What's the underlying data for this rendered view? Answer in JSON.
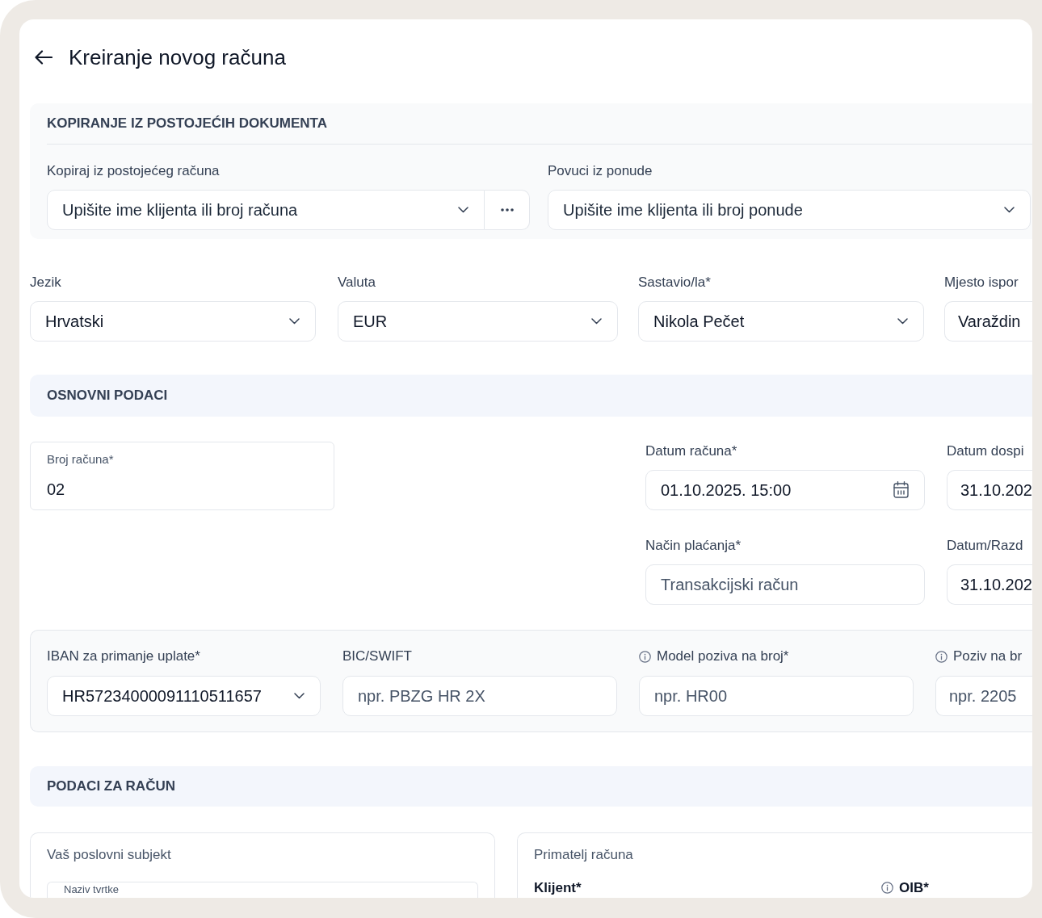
{
  "header": {
    "title": "Kreiranje novog računa"
  },
  "copy_section": {
    "title": "KOPIRANJE IZ POSTOJEĆIH DOKUMENTA",
    "fields": [
      {
        "label": "Kopiraj iz postojećeg računa",
        "placeholder": "Upišite ime klijenta ili broj računa",
        "kind": "search_more"
      },
      {
        "label": "Povuci iz ponude",
        "placeholder": "Upišite ime klijenta ili broj ponude",
        "kind": "search"
      }
    ]
  },
  "general_fields": [
    {
      "label": "Jezik",
      "value": "Hrvatski",
      "kind": "select"
    },
    {
      "label": "Valuta",
      "value": "EUR",
      "kind": "select"
    },
    {
      "label": "Sastavio/la*",
      "value": "Nikola Pečet",
      "kind": "select"
    },
    {
      "label": "Mjesto ispor",
      "value": "Varaždin",
      "kind": "text"
    }
  ],
  "basic_section": {
    "title": "OSNOVNI PODACI",
    "invoice_number": {
      "label": "Broj računa*",
      "value": "02"
    },
    "fields": [
      {
        "label": "Datum računa*",
        "value": "01.10.2025. 15:00",
        "kind": "date"
      },
      {
        "label": "Datum dospi",
        "value": "31.10.202",
        "kind": "text"
      },
      {
        "label": "Način plaćanja*",
        "placeholder": "Transakcijski račun",
        "kind": "text"
      },
      {
        "label": "Datum/Razd",
        "value": "31.10.202",
        "kind": "text"
      }
    ]
  },
  "payment_section": {
    "fields": [
      {
        "label": "IBAN za primanje uplate*",
        "value": "HR57234000091110511657",
        "kind": "select",
        "info": false
      },
      {
        "label": "BIC/SWIFT",
        "placeholder": "npr. PBZG HR 2X",
        "kind": "text",
        "info": false
      },
      {
        "label": "Model poziva na broj*",
        "placeholder": "npr. HR00",
        "kind": "text",
        "info": true
      },
      {
        "label": "Poziv na br",
        "placeholder": "npr. 2205",
        "kind": "text",
        "info": true
      }
    ]
  },
  "invoice_data_section": {
    "title": "PODACI ZA RAČUN",
    "issuer": {
      "title": "Vaš poslovni subjekt",
      "field": {
        "label": "Naziv tvrtke"
      }
    },
    "recipient": {
      "title": "Primatelj računa",
      "fields": [
        {
          "label": "Klijent*",
          "info": false
        },
        {
          "label": "OIB*",
          "info": true
        }
      ]
    }
  }
}
